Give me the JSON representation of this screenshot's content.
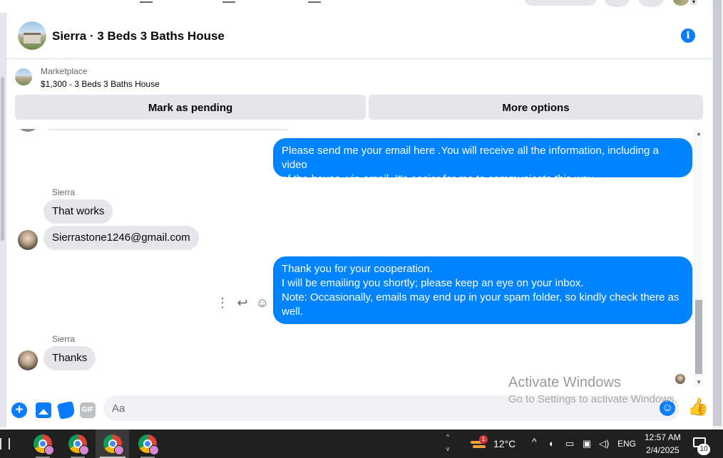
{
  "conversation": {
    "title": "Sierra · 3 Beds 3 Baths House",
    "info_icon": "info-icon"
  },
  "marketplace": {
    "label": "Marketplace",
    "listing": "$1,300 - 3 Beds 3 Baths House",
    "pending_button": "Mark as pending",
    "more_button": "More options"
  },
  "messages": {
    "out_1": {
      "line1": "Please send me your email here .You will receive all the information, including a video",
      "line2": "of the house, via email. It's easier for me to communicate this way"
    },
    "sender_1": "Sierra",
    "in_1": "That works",
    "in_2": "Sierrastone1246@gmail.com",
    "out_2": {
      "line1": "Thank you for your cooperation.",
      "line2": "I will be emailing you shortly; please keep an eye on your inbox.",
      "line3": "Note: Occasionally, emails may end up in your spam folder, so kindly check there as",
      "line4": "well."
    },
    "sender_2": "Sierra",
    "in_3": "Thanks"
  },
  "hover_tools": {
    "more": "⋮",
    "reply": "↩",
    "react": "☺"
  },
  "composer": {
    "placeholder": "Aa",
    "gif_label": "GIF",
    "icons": [
      "plus-icon",
      "photo-icon",
      "sticker-icon",
      "gif-icon",
      "emoji-icon",
      "thumbs-up-icon"
    ]
  },
  "watermark": {
    "title": "Activate Windows",
    "subtitle": "Go to Settings to activate Windows."
  },
  "taskbar": {
    "weather_temp": "12°C",
    "weather_badge": "1",
    "language": "ENG",
    "time": "12:57 AM",
    "date": "2/4/2025",
    "notification_count": "10",
    "tray_chevron_up": "^",
    "tray_chevron_down": "v"
  },
  "colors": {
    "messenger_blue": "#0084ff",
    "incoming_bubble": "#e4e6eb",
    "taskbar": "#202020"
  }
}
